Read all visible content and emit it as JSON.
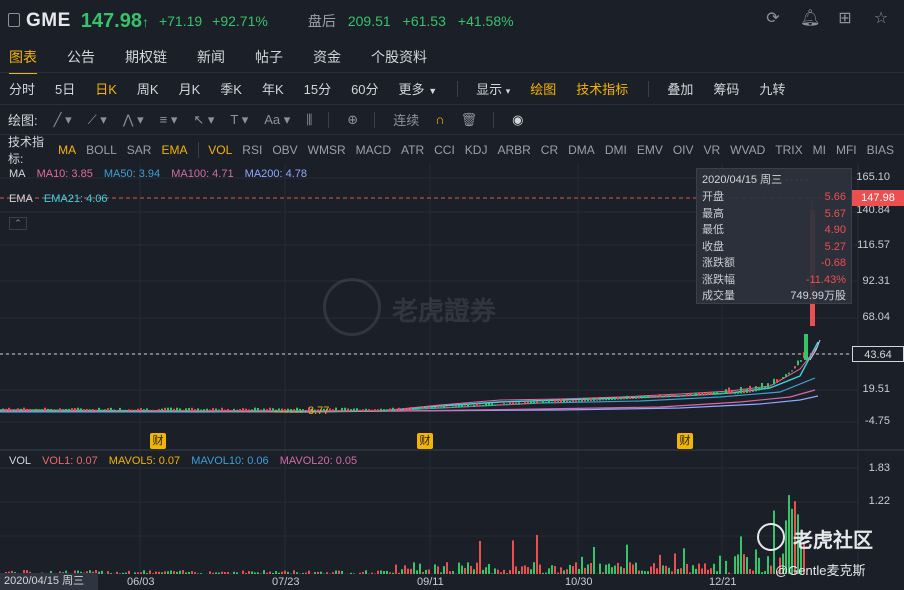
{
  "header": {
    "ticker": "GME",
    "price": "147.98",
    "change": "+71.19",
    "change_pct": "+92.71%",
    "after_hours_label": "盘后",
    "ah_price": "209.51",
    "ah_change": "+61.53",
    "ah_change_pct": "+41.58%"
  },
  "tabs": [
    "图表",
    "公告",
    "期权链",
    "新闻",
    "帖子",
    "资金",
    "个股资料"
  ],
  "periods": [
    "分时",
    "5日",
    "日K",
    "周K",
    "月K",
    "季K",
    "年K",
    "15分",
    "60分",
    "更多"
  ],
  "options": [
    "显示",
    "绘图",
    "技术指标"
  ],
  "extras": [
    "叠加",
    "筹码",
    "九转"
  ],
  "draw": {
    "label": "绘图:",
    "continuous": "连续"
  },
  "indicators": {
    "label": "技术指标:",
    "items": [
      "MA",
      "BOLL",
      "SAR",
      "EMA",
      "VOL",
      "RSI",
      "OBV",
      "WMSR",
      "MACD",
      "ATR",
      "CCI",
      "KDJ",
      "ARBR",
      "CR",
      "DMA",
      "DMI",
      "EMV",
      "OIV",
      "VR",
      "WVAD",
      "TRIX",
      "MI",
      "MFI",
      "BIAS"
    ]
  },
  "legend_ma": {
    "label": "MA",
    "ma10": "MA10: 3.85",
    "ma50": "MA50: 3.94",
    "ma100": "MA100: 4.71",
    "ma200": "MA200: 4.78"
  },
  "legend_ema": {
    "label": "EMA",
    "ema21": "EMA21: 4.06"
  },
  "legend_vol": {
    "label": "VOL",
    "vol1": "VOL1: 0.07",
    "mavol5": "MAVOL5: 0.07",
    "mavol10": "MAVOL10: 0.06",
    "mavol20": "MAVOL20: 0.05"
  },
  "tooltip": {
    "date": "2020/04/15 周三",
    "rows": [
      {
        "k": "开盘",
        "v": "5.66"
      },
      {
        "k": "最高",
        "v": "5.67"
      },
      {
        "k": "最低",
        "v": "4.90"
      },
      {
        "k": "收盘",
        "v": "5.27"
      },
      {
        "k": "涨跌额",
        "v": "-0.68"
      },
      {
        "k": "涨跌幅",
        "v": "-11.43%"
      },
      {
        "k": "成交量",
        "v": "749.99万股"
      }
    ]
  },
  "price_axis": [
    "165.10",
    "140.84",
    "116.57",
    "92.31",
    "68.04",
    "43.64",
    "19.51",
    "-4.75"
  ],
  "current_price_tag": "147.98",
  "crosshair_price_tag": "43.64",
  "min_label": "3.77",
  "earnings_badge": "财",
  "volume_axis": [
    "1.83",
    "1.22"
  ],
  "x_dates": [
    "06/03",
    "07/23",
    "09/11",
    "10/30",
    "12/21"
  ],
  "cursor_date": "2020/04/15 周三",
  "watermark": "老虎證券",
  "brand": "老虎社区",
  "author": "@Gentle麦克斯",
  "colors": {
    "up": "#34c46a",
    "down": "#ec4f4f",
    "accent": "#f5b400",
    "ma10": "#e36aa0",
    "ma50": "#3aa0d8",
    "ma100": "#d36aa8",
    "ma200": "#8fa8ff",
    "ema21": "#3cd4e0"
  }
}
